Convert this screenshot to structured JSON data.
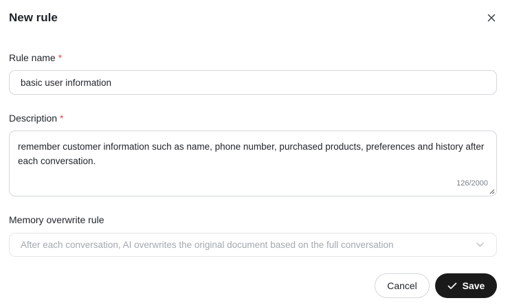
{
  "dialog": {
    "title": "New rule"
  },
  "fields": {
    "rule_name": {
      "label": "Rule name",
      "required_mark": "*",
      "value": "basic user information"
    },
    "description": {
      "label": "Description",
      "required_mark": "*",
      "value": "remember customer information such as name, phone number, purchased products, preferences and history after each conversation.",
      "counter": "126/2000"
    },
    "memory_overwrite": {
      "label": "Memory overwrite rule",
      "selected": "After each conversation, AI overwrites the original document based on the full conversation"
    }
  },
  "actions": {
    "cancel_label": "Cancel",
    "save_label": "Save"
  },
  "icons": {
    "close": "close-icon",
    "chevron": "chevron-down-icon",
    "check": "check-icon"
  },
  "colors": {
    "required": "#e5484d",
    "primary_button": "#1a1a1a"
  }
}
